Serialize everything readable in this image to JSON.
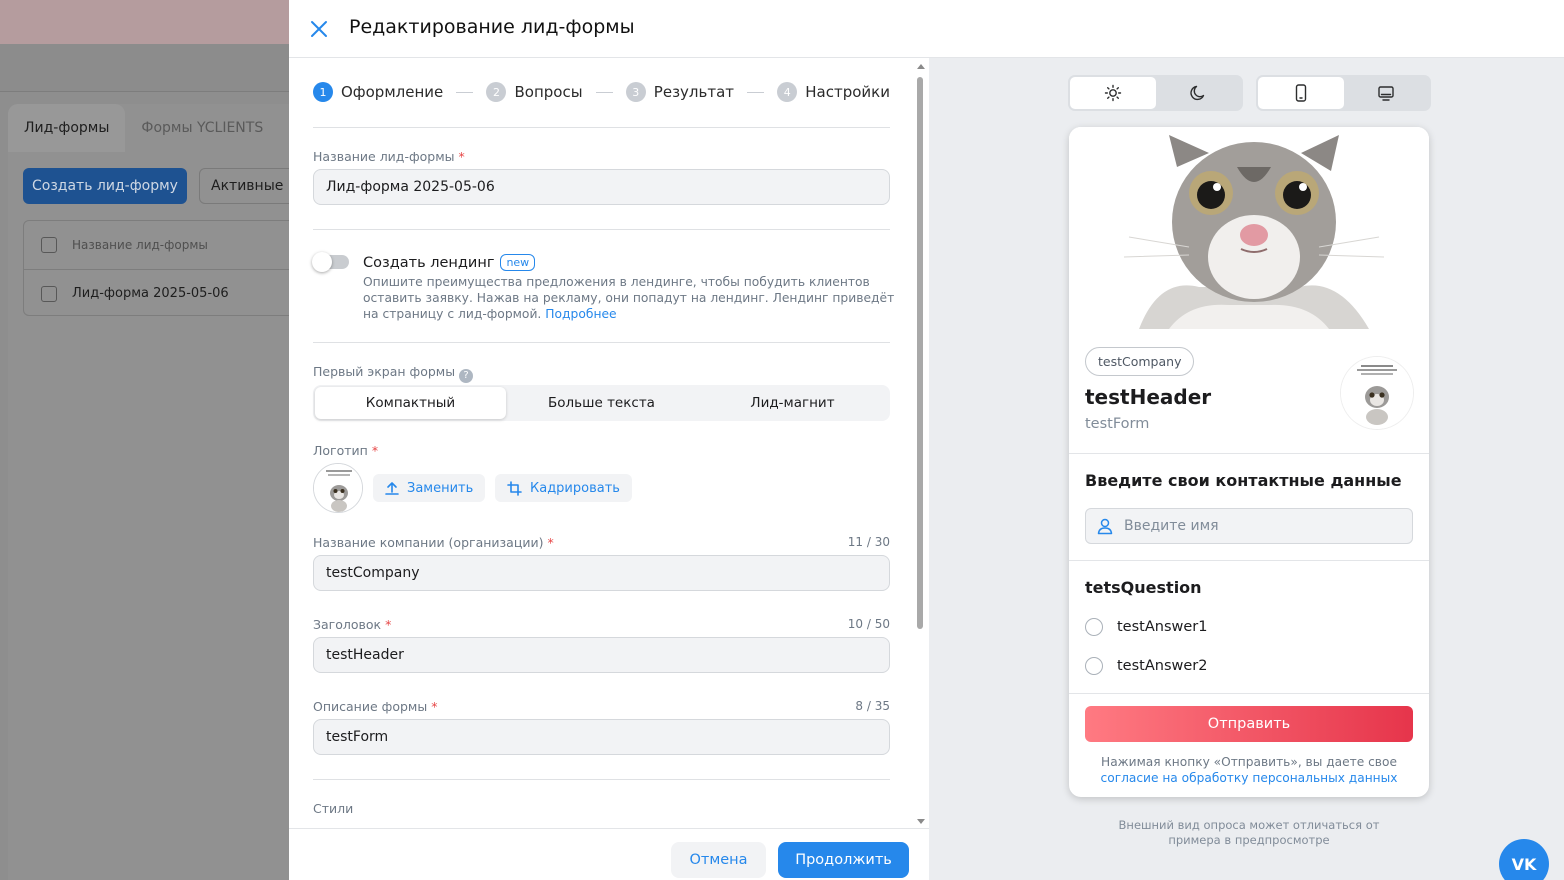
{
  "background": {
    "tabs": [
      "Лид-формы",
      "Формы YCLIENTS"
    ],
    "create_button": "Создать лид-форму",
    "filter_button": "Активные",
    "table_header": "Название лид-формы",
    "table_row": "Лид-форма 2025-05-06"
  },
  "drawer": {
    "title": "Редактирование лид-формы"
  },
  "steps": [
    {
      "num": "1",
      "label": "Оформление"
    },
    {
      "num": "2",
      "label": "Вопросы"
    },
    {
      "num": "3",
      "label": "Результат"
    },
    {
      "num": "4",
      "label": "Настройки"
    }
  ],
  "form_name": {
    "label": "Название лид-формы",
    "value": "Лид-форма 2025-05-06"
  },
  "landing": {
    "title": "Создать лендинг",
    "badge": "new",
    "description": "Опишите преимущества предложения в лендинге, чтобы побудить клиентов оставить заявку. Нажав на рекламу, они попадут на лендинг. Лендинг приведёт на страницу с лид-формой.",
    "more_link": "Подробнее"
  },
  "first_screen": {
    "label": "Первый экран формы",
    "help": "?",
    "options": [
      "Компактный",
      "Больше текста",
      "Лид-магнит"
    ]
  },
  "logo": {
    "label": "Логотип",
    "replace_button": "Заменить",
    "crop_button": "Кадрировать"
  },
  "company": {
    "label": "Название компании (организации)",
    "counter": "11 / 30",
    "value": "testCompany"
  },
  "header_field": {
    "label": "Заголовок",
    "counter": "10 / 50",
    "value": "testHeader"
  },
  "description_field": {
    "label": "Описание формы",
    "counter": "8 / 35",
    "value": "testForm"
  },
  "styles_label": "Стили",
  "footer": {
    "cancel": "Отмена",
    "continue": "Продолжить"
  },
  "preview": {
    "company_chip": "testCompany",
    "header": "testHeader",
    "description": "testForm",
    "contacts_title": "Введите свои контактные данные",
    "name_placeholder": "Введите имя",
    "question": "tetsQuestion",
    "answers": [
      "testAnswer1",
      "testAnswer2"
    ],
    "submit": "Отправить",
    "consent_text": "Нажимая кнопку «Отправить», вы даете свое",
    "consent_link": "согласие на обработку персональных данных",
    "note": "Внешний вид опроса может отличаться от примера в предпросмотре",
    "vk_label": "VK"
  },
  "colors": {
    "accent": "#2688eb",
    "required": "#e64646",
    "submit_from": "#ff7a82",
    "submit_to": "#e6354b"
  }
}
